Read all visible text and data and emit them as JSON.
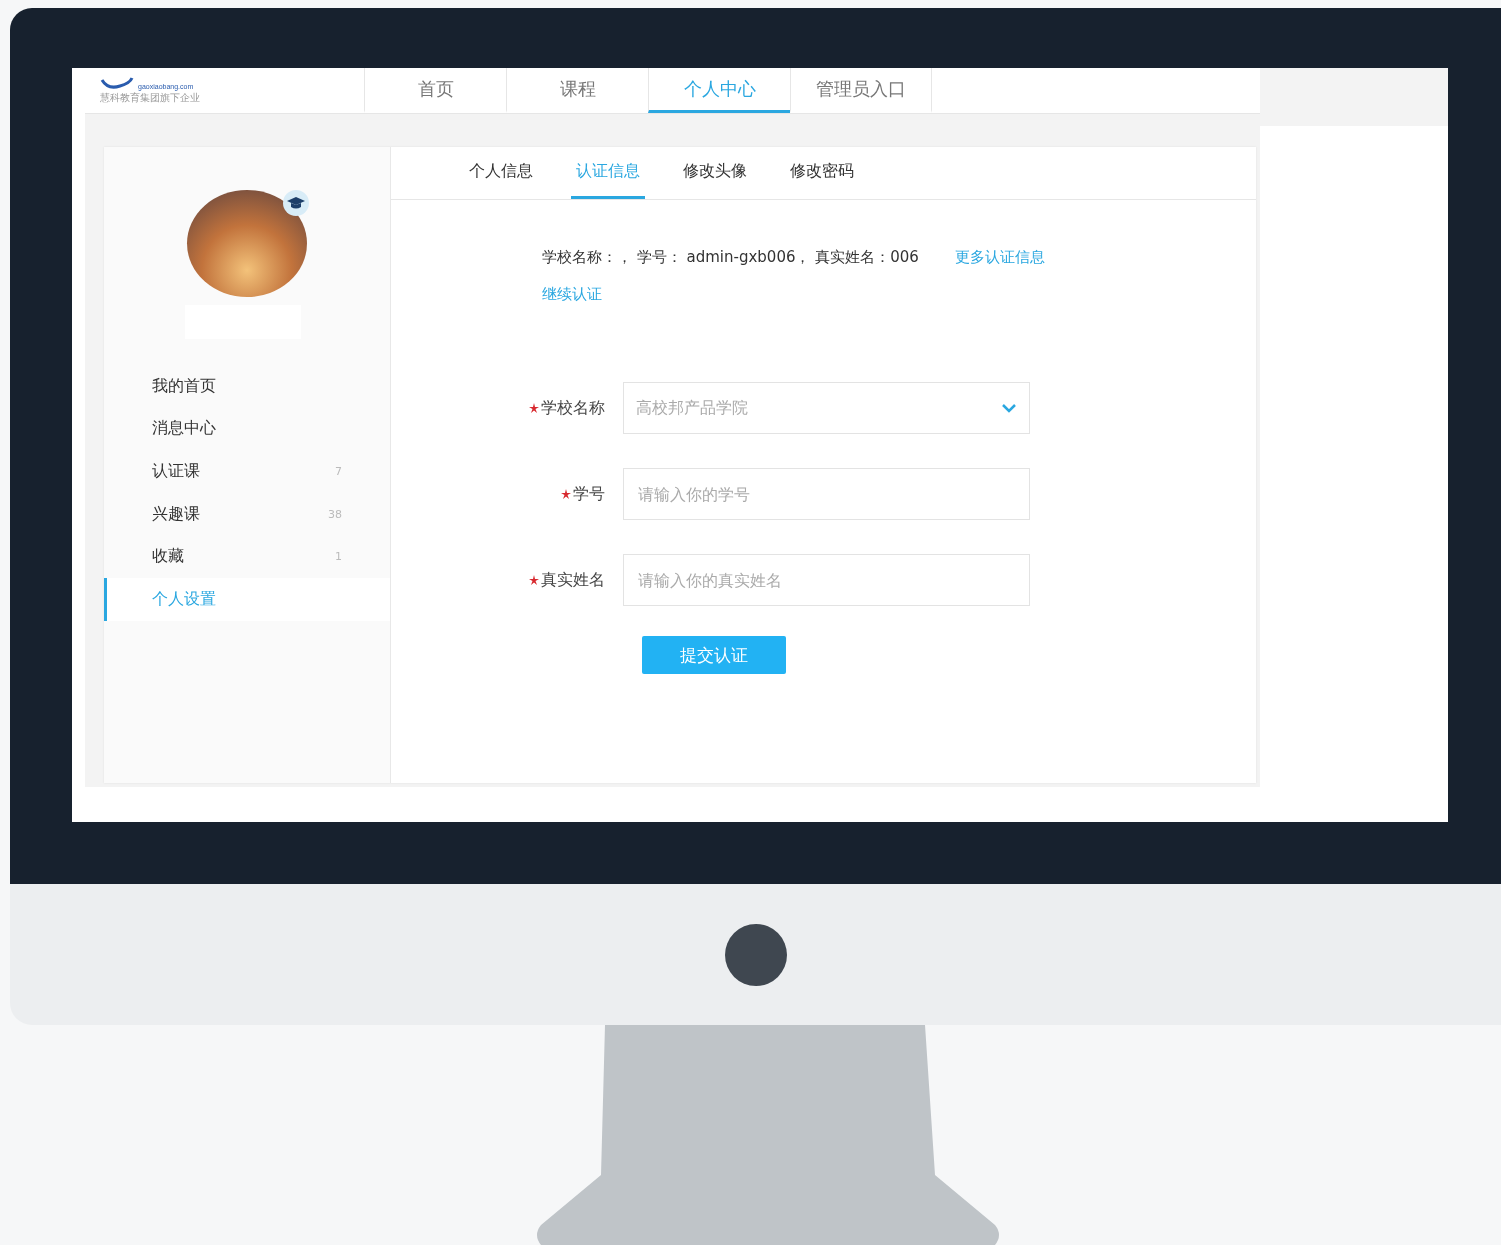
{
  "logo": {
    "domain": "gaoxiaobang.com",
    "tagline": "慧科教育集团旗下企业"
  },
  "nav": [
    {
      "label": "首页",
      "selected": false
    },
    {
      "label": "课程",
      "selected": false
    },
    {
      "label": "个人中心",
      "selected": true
    },
    {
      "label": "管理员入口",
      "selected": false
    }
  ],
  "sidebar": {
    "items": [
      {
        "label": "我的首页",
        "selected": false
      },
      {
        "label": "消息中心",
        "selected": false
      },
      {
        "label": "认证课",
        "count": "7",
        "selected": false
      },
      {
        "label": "兴趣课",
        "count": "38",
        "selected": false
      },
      {
        "label": "收藏",
        "count": "1",
        "selected": false
      },
      {
        "label": "个人设置",
        "selected": true
      }
    ]
  },
  "tabs": [
    {
      "label": "个人信息",
      "selected": false
    },
    {
      "label": "认证信息",
      "selected": true
    },
    {
      "label": "修改头像",
      "selected": false
    },
    {
      "label": "修改密码",
      "selected": false
    }
  ],
  "info": {
    "text": "学校名称：， 学号： admin-gxb006， 真实姓名：006",
    "more_link": "更多认证信息",
    "continue_link": "继续认证"
  },
  "form": {
    "fields": [
      {
        "kind": "select",
        "label": "学校名称",
        "required": true,
        "value": "高校邦产品学院"
      },
      {
        "kind": "text",
        "label": "学号",
        "required": true,
        "placeholder": "请输入你的学号"
      },
      {
        "kind": "text",
        "label": "真实姓名",
        "required": true,
        "placeholder": "请输入你的真实姓名"
      }
    ],
    "submit": "提交认证"
  }
}
